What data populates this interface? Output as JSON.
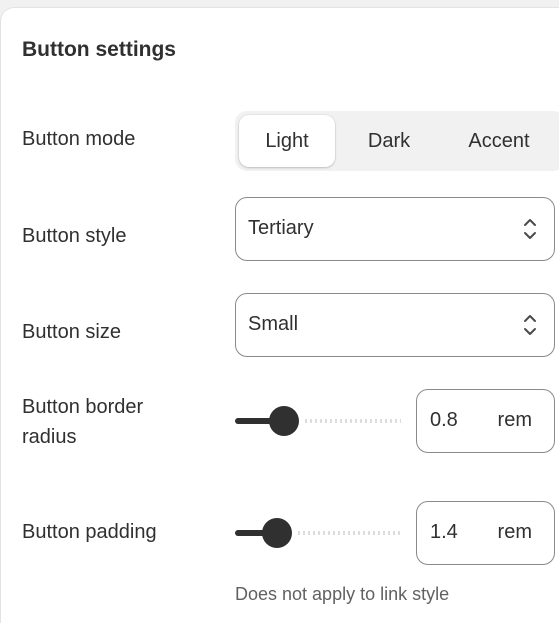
{
  "panel": {
    "title": "Button settings"
  },
  "button_mode": {
    "label": "Button mode",
    "options": [
      "Light",
      "Dark",
      "Accent"
    ],
    "selected": "Light"
  },
  "button_style": {
    "label": "Button style",
    "value": "Tertiary"
  },
  "button_size": {
    "label": "Button size",
    "value": "Small"
  },
  "border_radius": {
    "label_line1": "Button border",
    "label_line2": "radius",
    "value": "0.8",
    "unit": "rem",
    "slider_fraction": 0.25
  },
  "padding": {
    "label": "Button padding",
    "value": "1.4",
    "unit": "rem",
    "slider_fraction": 0.2,
    "help_text": "Does not apply to link style"
  },
  "colors": {
    "text": "#303030",
    "border": "#8a8a8a",
    "muted": "#616161",
    "segment_bg": "#f1f1f1"
  },
  "icons": {
    "select_chevron": "chevron-up-down-icon"
  }
}
